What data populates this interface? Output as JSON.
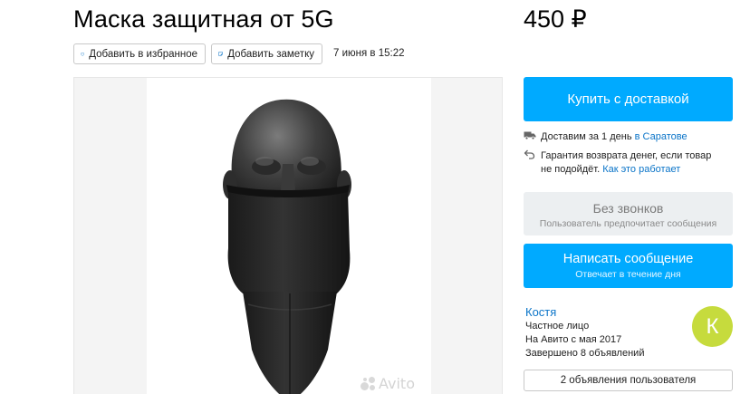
{
  "listing": {
    "title": "Маска защитная от 5G",
    "price": "450 ₽",
    "date": "7 июня в 15:22"
  },
  "actions": {
    "favorite_label": "Добавить в избранное",
    "note_label": "Добавить заметку"
  },
  "gallery": {
    "watermark": "Avito"
  },
  "sidebar": {
    "buy_label": "Купить с доставкой",
    "delivery_text": "Доставим за 1 день",
    "delivery_city": "в Саратове",
    "guarantee_text_1": "Гарантия возврата денег, если товар",
    "guarantee_text_2": "не подойдёт.",
    "guarantee_link": "Как это работает",
    "no_calls_title": "Без звонков",
    "no_calls_sub": "Пользователь предпочитает сообщения",
    "message_label": "Написать сообщение",
    "message_sub": "Отвечает в течение дня"
  },
  "seller": {
    "name": "Костя",
    "type": "Частное лицо",
    "since": "На Авито с мая 2017",
    "completed": "Завершено 8 объявлений",
    "avatar_letter": "К",
    "ads_button": "2 объявления пользователя"
  },
  "colors": {
    "accent": "#00aaff",
    "link": "#0a74c8",
    "avatar": "#c6db3d"
  }
}
